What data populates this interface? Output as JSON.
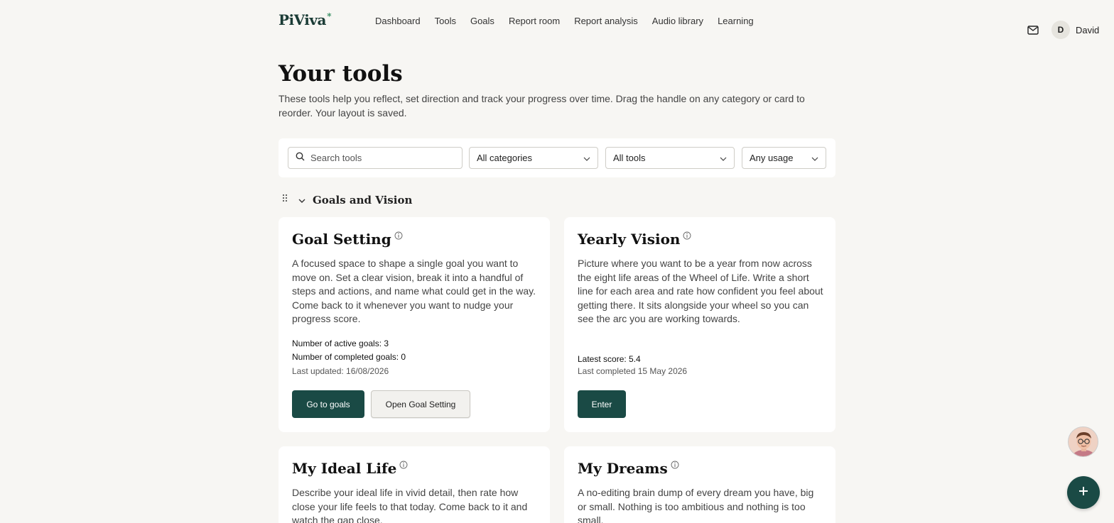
{
  "brand": {
    "name": "PiViva",
    "mark": "*"
  },
  "nav": [
    "Dashboard",
    "Tools",
    "Goals",
    "Report room",
    "Report analysis",
    "Audio library",
    "Learning"
  ],
  "user": {
    "initial": "D",
    "name": "David"
  },
  "header": {
    "title": "Your tools",
    "description": "These tools help you reflect, set direction and track your progress over time. Drag the handle on any category or card to reorder. Your layout is saved."
  },
  "filters": {
    "search_placeholder": "Search tools",
    "category": "All categories",
    "tools": "All tools",
    "usage": "Any usage"
  },
  "section": {
    "title": "Goals and Vision"
  },
  "cards": [
    {
      "title": "Goal Setting",
      "description": "A focused space to shape a single goal you want to move on. Set a clear vision, break it into a handful of steps and actions, and name what could get in the way. Come back to it whenever you want to nudge your progress score.",
      "stat1": "Number of active goals: 3",
      "stat2": "Number of completed goals: 0",
      "updated": "Last updated: 16/08/2026",
      "primary": "Go to goals",
      "secondary": "Open Goal Setting"
    },
    {
      "title": "Yearly Vision",
      "description": "Picture where you want to be a year from now across the eight life areas of the Wheel of Life. Write a short line for each area and rate how confident you feel about getting there. It sits alongside your wheel so you can see the arc you are working towards.",
      "stat1": "Latest score: 5.4",
      "updated": "Last completed 15 May 2026",
      "primary": "Enter"
    },
    {
      "title": "My Ideal Life",
      "description": "Describe your ideal life in vivid detail, then rate how close your life feels to that today. Come back to it and watch the gap close."
    },
    {
      "title": "My Dreams",
      "description": "A no-editing brain dump of every dream you have, big or small. Nothing is too ambitious and nothing is too small."
    }
  ],
  "colors": {
    "primary": "#1a4a45",
    "background": "#f7f6f3",
    "card": "#ffffff"
  },
  "icons": [
    "mail-icon",
    "search-icon",
    "chevron-down-icon",
    "drag-handle-icon",
    "info-icon",
    "plus-icon"
  ]
}
